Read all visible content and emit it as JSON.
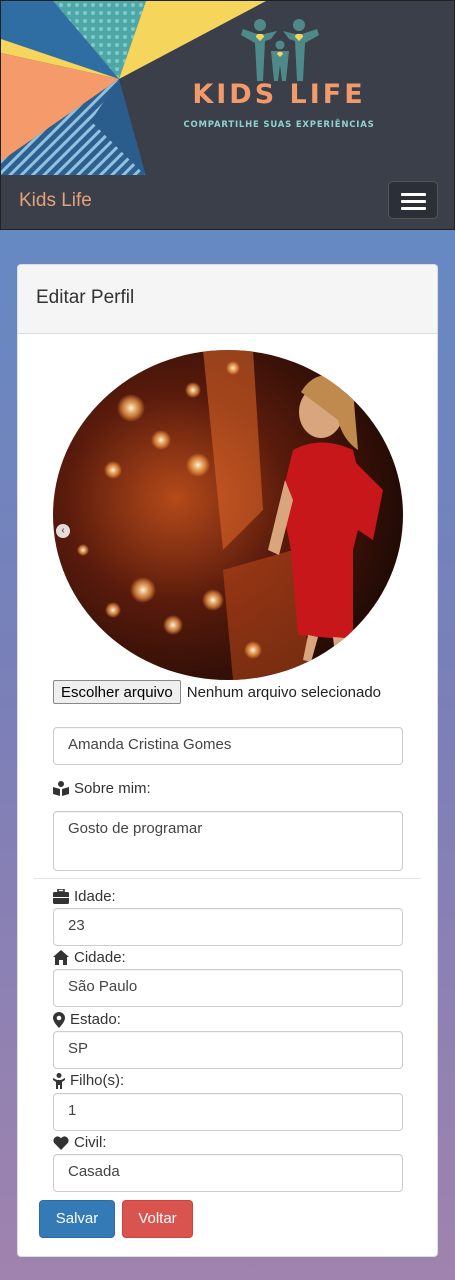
{
  "header": {
    "logo_title": "KIDS LIFE",
    "logo_tagline": "COMPARTILHE SUAS EXPERIÊNCIAS"
  },
  "navbar": {
    "brand": "Kids Life",
    "menu_icon": "hamburger-icon"
  },
  "card": {
    "title": "Editar Perfil"
  },
  "profile": {
    "photo_alt": "profile-photo",
    "carousel_prev_icon": "chevron-left-icon"
  },
  "file_input": {
    "button_label": "Escolher arquivo",
    "status": "Nenhum arquivo selecionado"
  },
  "form": {
    "name": {
      "value": "Amanda Cristina Gomes"
    },
    "about": {
      "label": "Sobre mim:",
      "icon": "book-reader-icon",
      "value": "Gosto de programar"
    },
    "age": {
      "label": "Idade:",
      "icon": "briefcase-icon",
      "value": "23"
    },
    "city": {
      "label": "Cidade:",
      "icon": "home-icon",
      "value": "São Paulo"
    },
    "state": {
      "label": "Estado:",
      "icon": "map-marker-icon",
      "value": "SP"
    },
    "children": {
      "label": "Filho(s):",
      "icon": "child-icon",
      "value": "1"
    },
    "civil": {
      "label": "Civil:",
      "icon": "heart-icon",
      "value": "Casada"
    }
  },
  "actions": {
    "save_label": "Salvar",
    "back_label": "Voltar"
  },
  "colors": {
    "brand": "#e8a178",
    "navbar_bg": "#3a3f4a",
    "save": "#337ab7",
    "back": "#d9534f"
  }
}
